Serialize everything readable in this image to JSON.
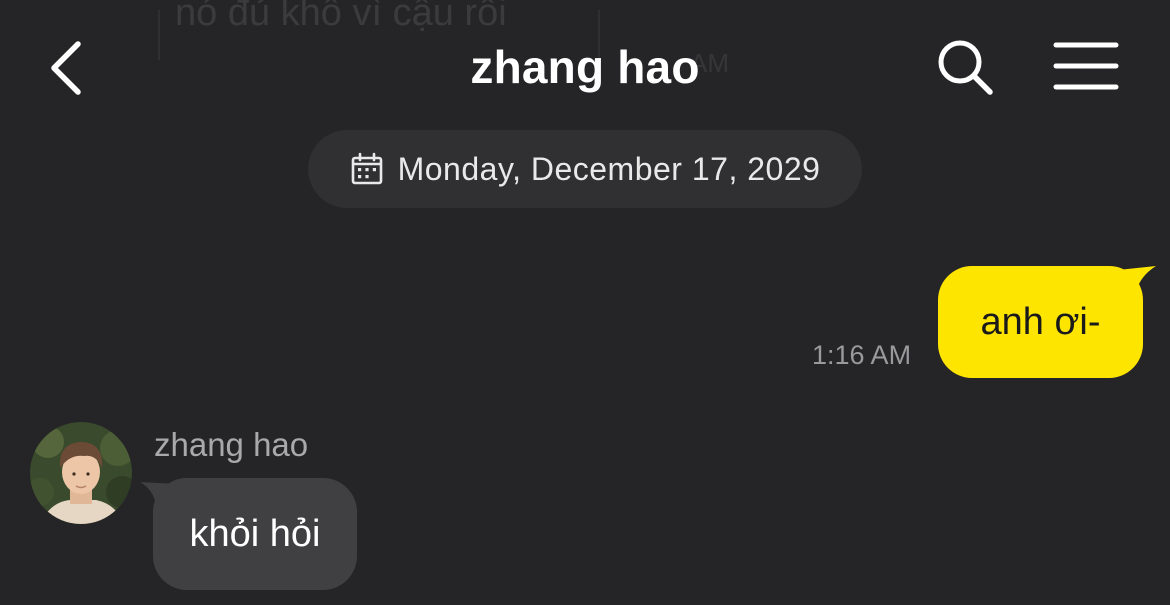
{
  "background": {
    "ghost_text": "nó đủ khổ vì cậu rồi",
    "ghost_time": "AM"
  },
  "header": {
    "title": "zhang hao",
    "back_icon": "chevron-left-icon",
    "search_icon": "search-icon",
    "menu_icon": "hamburger-menu-icon"
  },
  "date_divider": {
    "icon": "calendar-icon",
    "text": "Monday, December 17, 2029"
  },
  "messages": [
    {
      "direction": "outgoing",
      "text": "anh ơi-",
      "time": "1:16 AM",
      "bubble_color": "#fee500"
    },
    {
      "direction": "incoming",
      "sender": "zhang hao",
      "text": "khỏi hỏi",
      "bubble_color": "#404043"
    }
  ],
  "colors": {
    "background": "#252527",
    "accent_yellow": "#fee500",
    "pill": "#303033",
    "timestamp": "#9a9a9d"
  }
}
